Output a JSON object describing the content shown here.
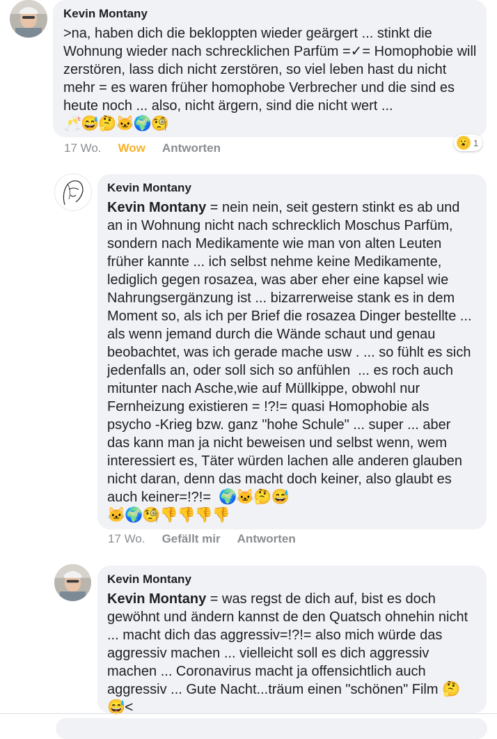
{
  "comments": [
    {
      "author": "Kevin Montany",
      "text": ">na, haben dich die bekloppten wieder geärgert ... stinkt die Wohnung wieder nach schrecklichen Parfüm =✓= Homophobie will zerstören, lass dich nicht zerstören, so viel leben hast du nicht mehr = es waren früher homophobe Verbrecher und die sind es heute noch ... also, nicht ärgern, sind die nicht wert ...",
      "emojis": "🥂😅🤔🐱🌍🧐",
      "time": "17 Wo.",
      "reaction_label": "Wow",
      "reply_label": "Antworten",
      "reaction_count": "1",
      "reaction_icon": "😮"
    },
    {
      "author": "Kevin Montany",
      "mention": "Kevin Montany",
      "text": " = nein nein, seit gestern stinkt es ab und an in Wohnung nicht nach schrecklich Moschus Parfüm, sondern nach Medikamente wie man von alten Leuten früher kannte ... ich selbst nehme keine Medikamente, lediglich gegen rosazea, was aber eher eine kapsel wie Nahrungsergänzung ist ... bizarrerweise stank es in dem Moment so, als ich per Brief die rosazea Dinger bestellte ... als wenn jemand durch die Wände schaut und genau beobachtet, was ich gerade mache usw . ... so fühlt es sich jedenfalls an, oder soll sich so anfühlen  ... es roch auch mitunter nach Asche,wie auf Müllkippe, obwohl nur Fernheizung existieren = !?!= quasi Homophobie als psycho -Krieg bzw. ganz \"hohe Schule\" ... super ... aber das kann man ja nicht beweisen und selbst wenn, wem interessiert es, Täter würden lachen alle anderen glauben nicht daran, denn das macht doch keiner, also glaubt es auch keiner=!?!=  ",
      "emojis_inline": "🌍🐱🤔😅",
      "emojis": "🐱🌍🧐👎👎👎👎",
      "time": "17 Wo.",
      "like_label": "Gefällt mir",
      "reply_label": "Antworten"
    },
    {
      "author": "Kevin Montany",
      "mention": "Kevin Montany",
      "text": " = was regst de dich auf, bist es doch gewöhnt und ändern kannst de den Quatsch ohnehin nicht ... macht dich das aggressiv=!?!= also mich würde das aggressiv machen ... vielleicht soll es dich aggressiv machen ... Coronavirus macht ja offensichtlich auch aggressiv ... Gute Nacht...träum einen \"schönen\" Film ",
      "emojis_inline": "🤔",
      "emojis": "😅<"
    }
  ]
}
